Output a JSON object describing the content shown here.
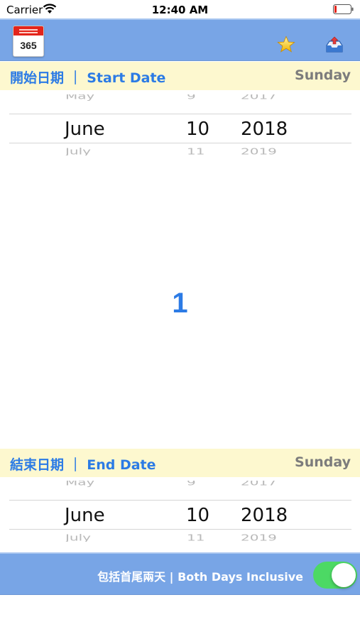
{
  "status_bar": {
    "carrier": "Carrier",
    "time": "12:40 AM"
  },
  "toolbar": {
    "logo_number": "365",
    "icons": [
      "star-icon",
      "share-inbox-icon"
    ]
  },
  "start_date": {
    "label": "開始日期 ｜ Start Date",
    "weekday": "Sunday",
    "picker": {
      "prev": {
        "month": "May",
        "day": "9",
        "year": "2017"
      },
      "selected": {
        "month": "June",
        "day": "10",
        "year": "2018"
      },
      "next": {
        "month": "July",
        "day": "11",
        "year": "2019"
      }
    }
  },
  "result": {
    "days": "1"
  },
  "end_date": {
    "label": "結束日期 ｜ End Date",
    "weekday": "Sunday",
    "picker": {
      "prev": {
        "month": "May",
        "day": "9",
        "year": "2017"
      },
      "selected": {
        "month": "June",
        "day": "10",
        "year": "2018"
      },
      "next": {
        "month": "July",
        "day": "11",
        "year": "2019"
      }
    }
  },
  "bottom_bar": {
    "inclusive_label": "包括首尾兩天 | Both Days Inclusive",
    "inclusive_on": true
  },
  "colors": {
    "toolbar": "#78a5e6",
    "header_bg": "#fdf8cf",
    "accent_blue": "#2c7be5",
    "weekday_gray": "#7c7c7c",
    "toggle_on": "#4cd964",
    "logo_red": "#e3241b"
  }
}
